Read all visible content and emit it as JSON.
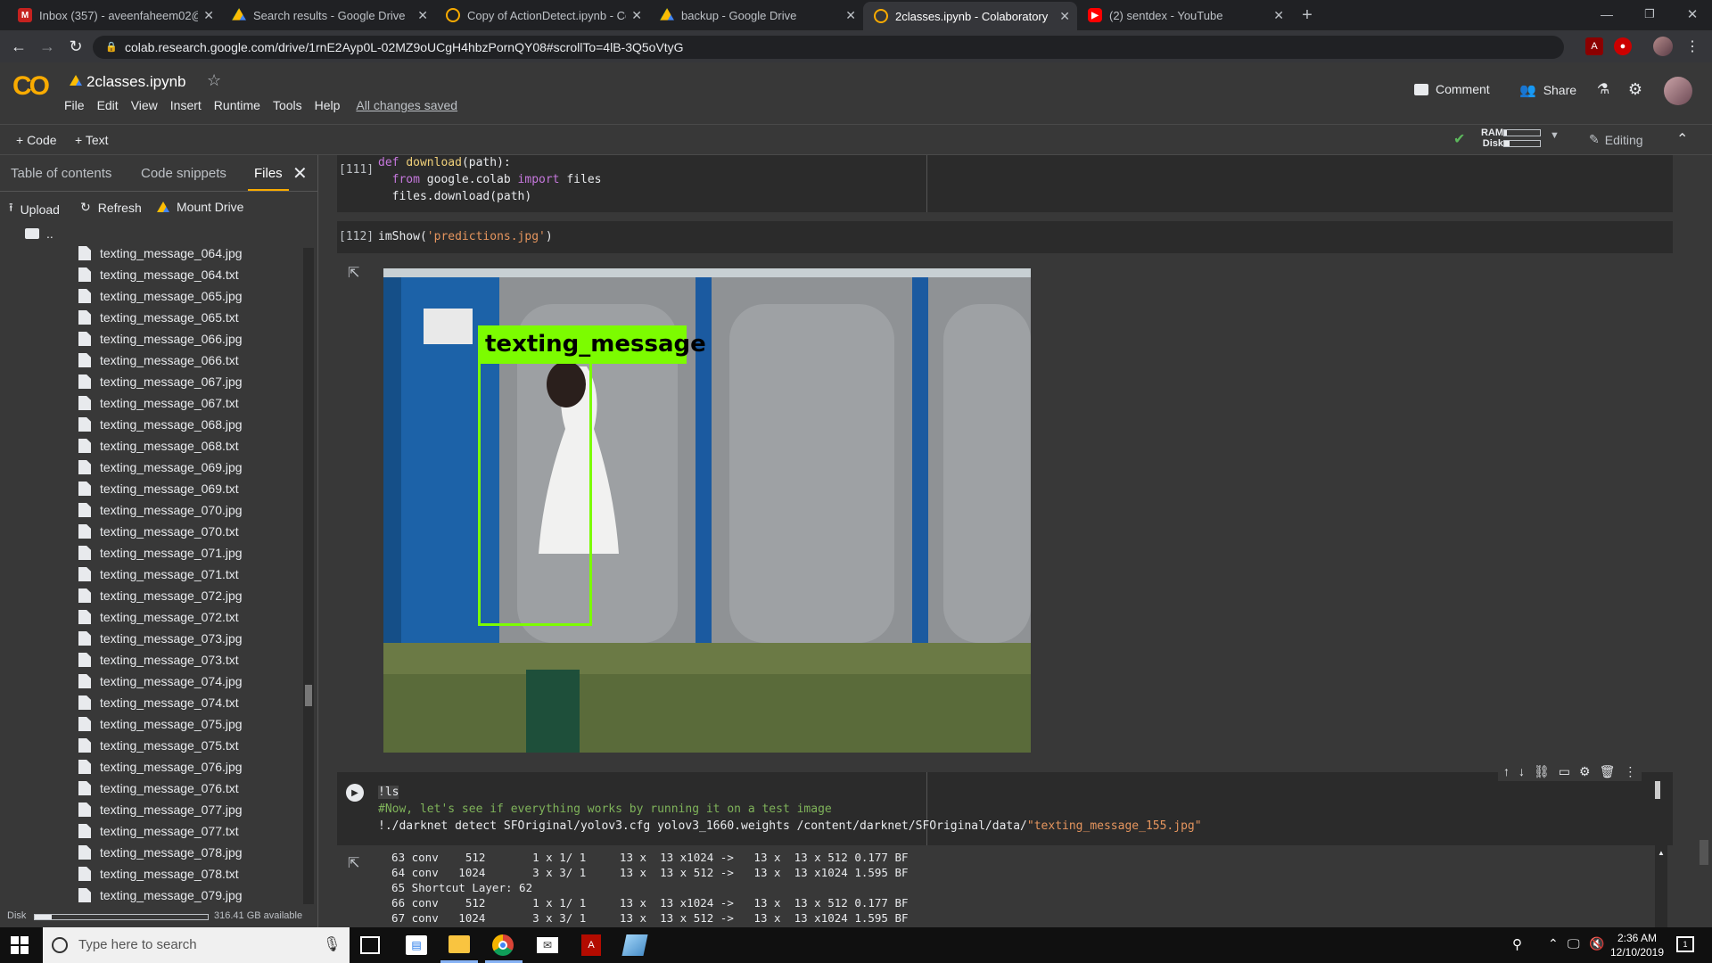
{
  "browser": {
    "tabs": [
      {
        "title": "Inbox (357) - aveenfaheem02@g",
        "icon": "gmail-icon"
      },
      {
        "title": "Search results - Google Drive",
        "icon": "drive-icon"
      },
      {
        "title": "Copy of ActionDetect.ipynb - Co",
        "icon": "colab-icon"
      },
      {
        "title": "backup - Google Drive",
        "icon": "drive-icon"
      },
      {
        "title": "2classes.ipynb - Colaboratory",
        "icon": "colab-icon",
        "active": true
      },
      {
        "title": "(2) sentdex - YouTube",
        "icon": "youtube-icon"
      }
    ],
    "url": "colab.research.google.com/drive/1rnE2Ayp0L-02MZ9oUCgH4hbzPornQY08#scrollTo=4lB-3Q5oVtyG"
  },
  "colab": {
    "logo": "CO",
    "notebook_title": "2classes.ipynb",
    "menu": [
      "File",
      "Edit",
      "View",
      "Insert",
      "Runtime",
      "Tools",
      "Help"
    ],
    "save_status": "All changes saved",
    "comment": "Comment",
    "share": "Share",
    "add_code": "+ Code",
    "add_text": "+ Text",
    "ram_label": "RAM",
    "disk_label": "Disk",
    "editing": "Editing"
  },
  "sidebar": {
    "tabs": [
      "Table of contents",
      "Code snippets",
      "Files"
    ],
    "actions": {
      "upload": "Upload",
      "refresh": "Refresh",
      "mount": "Mount Drive"
    },
    "parent_dir": "..",
    "files": [
      "texting_message_064.jpg",
      "texting_message_064.txt",
      "texting_message_065.jpg",
      "texting_message_065.txt",
      "texting_message_066.jpg",
      "texting_message_066.txt",
      "texting_message_067.jpg",
      "texting_message_067.txt",
      "texting_message_068.jpg",
      "texting_message_068.txt",
      "texting_message_069.jpg",
      "texting_message_069.txt",
      "texting_message_070.jpg",
      "texting_message_070.txt",
      "texting_message_071.jpg",
      "texting_message_071.txt",
      "texting_message_072.jpg",
      "texting_message_072.txt",
      "texting_message_073.jpg",
      "texting_message_073.txt",
      "texting_message_074.jpg",
      "texting_message_074.txt",
      "texting_message_075.jpg",
      "texting_message_075.txt",
      "texting_message_076.jpg",
      "texting_message_076.txt",
      "texting_message_077.jpg",
      "texting_message_077.txt",
      "texting_message_078.jpg",
      "texting_message_078.txt",
      "texting_message_079.jpg"
    ],
    "disk_label": "Disk",
    "disk_free": "316.41 GB available"
  },
  "cells": {
    "c111": {
      "count": "[111]"
    },
    "c112": {
      "count": "[112]",
      "code": "imShow('predictions.jpg')"
    },
    "detection_label": "texting_message",
    "output_lines": [
      "  63 conv    512       1 x 1/ 1     13 x  13 x1024 ->   13 x  13 x 512 0.177 BF",
      "  64 conv   1024       3 x 3/ 1     13 x  13 x 512 ->   13 x  13 x1024 1.595 BF",
      "  65 Shortcut Layer: 62",
      "  66 conv    512       1 x 1/ 1     13 x  13 x1024 ->   13 x  13 x 512 0.177 BF",
      "  67 conv   1024       3 x 3/ 1     13 x  13 x 512 ->   13 x  13 x1024 1.595 BF"
    ]
  },
  "taskbar": {
    "search_placeholder": "Type here to search",
    "time": "2:36 AM",
    "date": "12/10/2019"
  }
}
